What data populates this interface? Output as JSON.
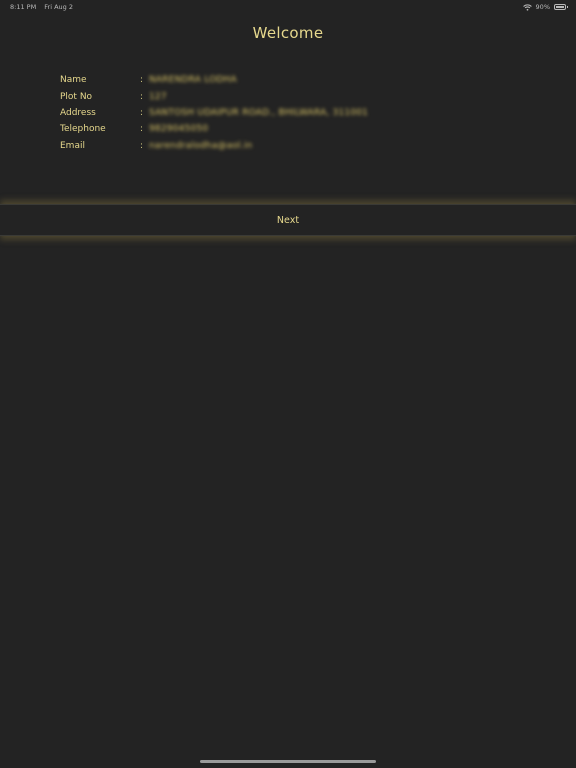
{
  "status_bar": {
    "time": "8:11 PM",
    "date": "Fri Aug 2",
    "battery": "90%"
  },
  "title": "Welcome",
  "fields": [
    {
      "label": "Name",
      "value": "NARENDRA LODHA"
    },
    {
      "label": "Plot No",
      "value": "127"
    },
    {
      "label": "Address",
      "value": "SANTOSH UDAIPUR ROAD., BHILWARA, 311001"
    },
    {
      "label": "Telephone",
      "value": "9829045050"
    },
    {
      "label": "Email",
      "value": "narendralodha@aol.in"
    }
  ],
  "separator": ":",
  "next_label": "Next",
  "colors": {
    "background": "#232323",
    "accent": "#e6d88d"
  }
}
